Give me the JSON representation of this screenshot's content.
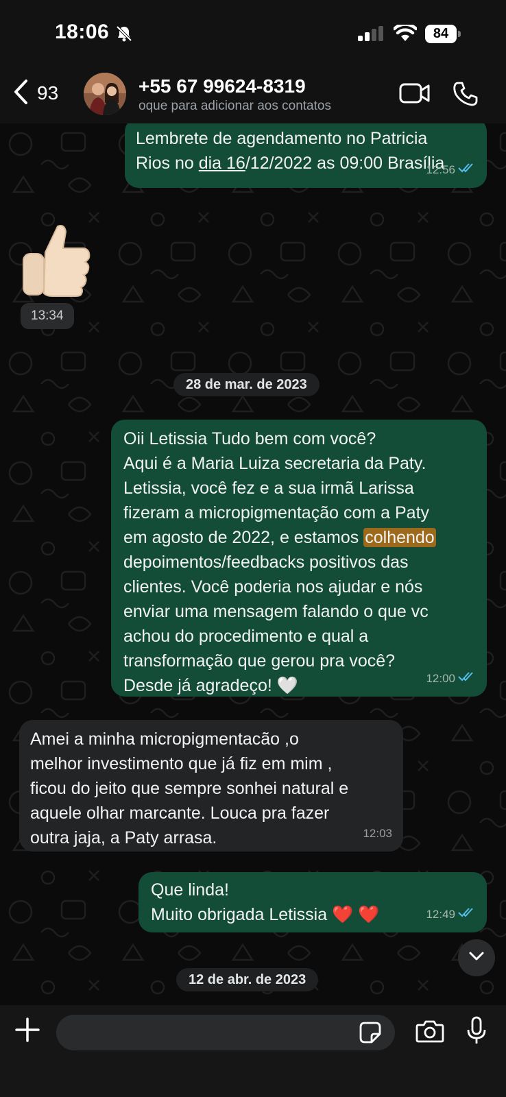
{
  "status_bar": {
    "time": "18:06",
    "battery": "84"
  },
  "header": {
    "back_count": "93",
    "contact_number": "+55 67 99624-8319",
    "contact_sub": "oque para adicionar aos contatos"
  },
  "messages": [
    {
      "text_a": "Lembrete de agendamento no Patricia\nRios no ",
      "text_link": "dia 16",
      "text_b": "/12/2022 as 09:00 Brasília",
      "time": "12:56"
    },
    {
      "sticker": "thumbs-up",
      "time": "13:34"
    },
    {
      "date": "28 de mar. de 2023"
    },
    {
      "text_a": "Oii Letissia Tudo bem com você?\nAqui é a Maria Luiza secretaria da Paty.\nLetissia, você fez e a sua irmã Larissa\nfizeram a micropigmentação com a Paty\nem agosto de 2022, e estamos ",
      "text_highlight": "colhendo",
      "text_b": "\ndepoimentos/feedbacks positivos das\nclientes. Você poderia nos ajudar e nós\nenviar uma mensagem falando o que vc\nachou do procedimento e qual a\ntransformação que gerou pra você?\nDesde já agradeço! 🤍",
      "time": "12:00"
    },
    {
      "text": "Amei a minha micropigmentacão ,o\nmelhor   investimento que já fiz em mim ,\nficou do jeito que sempre sonhei natural e\naquele olhar marcante. Louca pra fazer\noutra jaja, a Paty arrasa.",
      "time": "12:03"
    },
    {
      "text": "Que linda!\nMuito obrigada Letissia ❤️ ❤️",
      "time": "12:49"
    },
    {
      "date": "12 de abr. de 2023"
    }
  ],
  "icons": {
    "bell_slash": "bell-slash-icon",
    "signal": "signal-icon",
    "wifi": "wifi-icon",
    "back": "chevron-left-icon",
    "video": "video-camera-icon",
    "phone": "phone-icon",
    "read": "double-check-icon",
    "scroll_down": "chevron-down-icon",
    "plus": "plus-icon",
    "sticker": "sticker-icon",
    "camera": "camera-icon",
    "mic": "microphone-icon"
  },
  "colors": {
    "outgoing_bubble": "#144d37",
    "incoming_bubble": "#232426",
    "read_ticks": "#53bdeb",
    "highlight": "#9c6a1a"
  }
}
